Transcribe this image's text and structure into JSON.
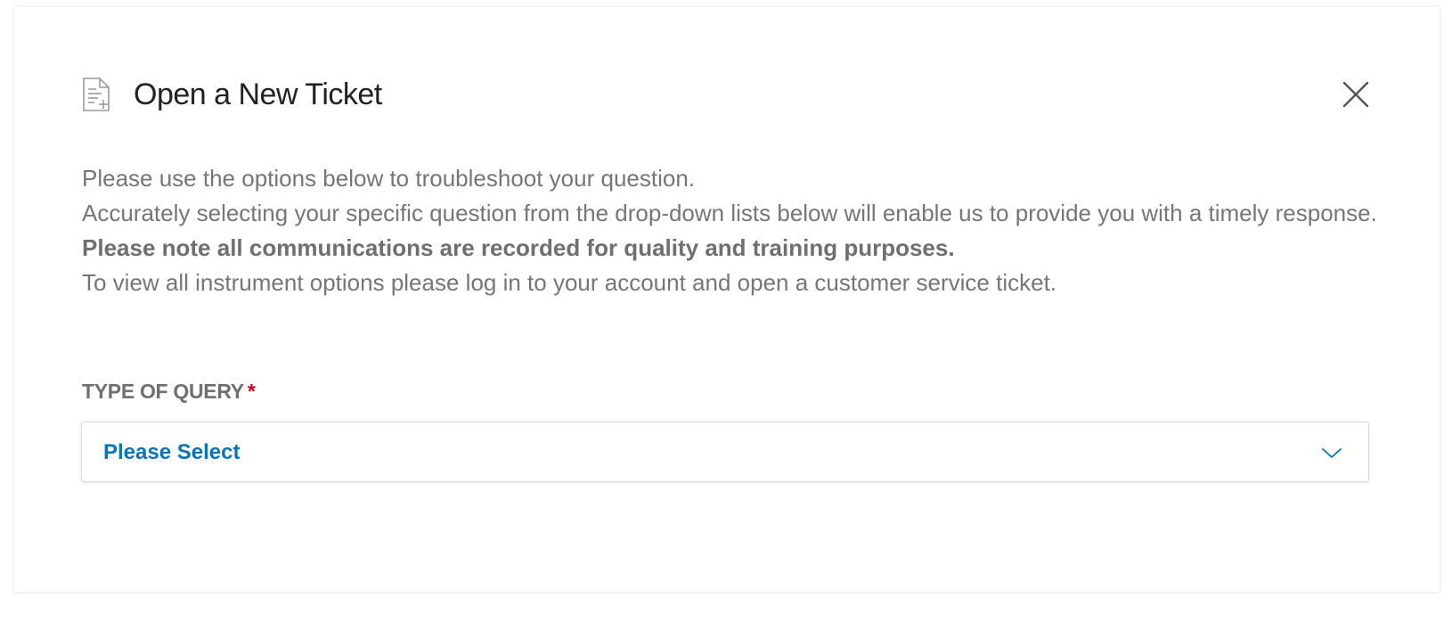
{
  "dialog": {
    "title": "Open a New Ticket",
    "icon": "document-add-icon",
    "close_icon": "close-icon"
  },
  "intro": {
    "line1": "Please use the options below to troubleshoot your question.",
    "line2": "Accurately selecting your specific question from the drop-down lists below will enable us to provide you with a timely response.",
    "line3": "Please note all communications are recorded for quality and training purposes.",
    "line4": "To view all instrument options please log in to your account and open a customer service ticket."
  },
  "form": {
    "query_type": {
      "label": "TYPE OF QUERY",
      "required_marker": "*",
      "selected_value": "Please Select",
      "icon": "chevron-down-icon"
    }
  },
  "colors": {
    "accent": "#0a74b9",
    "required": "#d0021b",
    "text_muted": "#767676",
    "title": "#222222"
  }
}
